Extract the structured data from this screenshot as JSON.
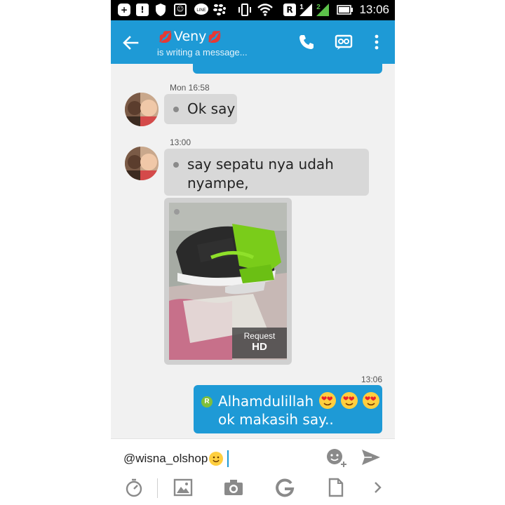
{
  "status_bar": {
    "time": "13:06",
    "r_label": "R",
    "sim1": "1",
    "sim2": "2"
  },
  "header": {
    "contact_name": "Veny",
    "contact_status": "is writing a message..."
  },
  "messages": [
    {
      "timestamp": "Mon 16:58",
      "text": "Ok say"
    },
    {
      "timestamp": "13:00",
      "text": "say sepatu nya udah nyampe,"
    },
    {
      "photo_request_label": "Request",
      "photo_hd_label": "HD"
    },
    {
      "timestamp": "13:06",
      "status_letter": "R",
      "line1": "Alhamdulillah",
      "line2": "ok makasih say.."
    }
  ],
  "input": {
    "value": "@wisna_olshop"
  },
  "colors": {
    "accent": "#1e9ad6",
    "incoming_bubble": "#d8d8d8",
    "status_bar": "#000000"
  }
}
